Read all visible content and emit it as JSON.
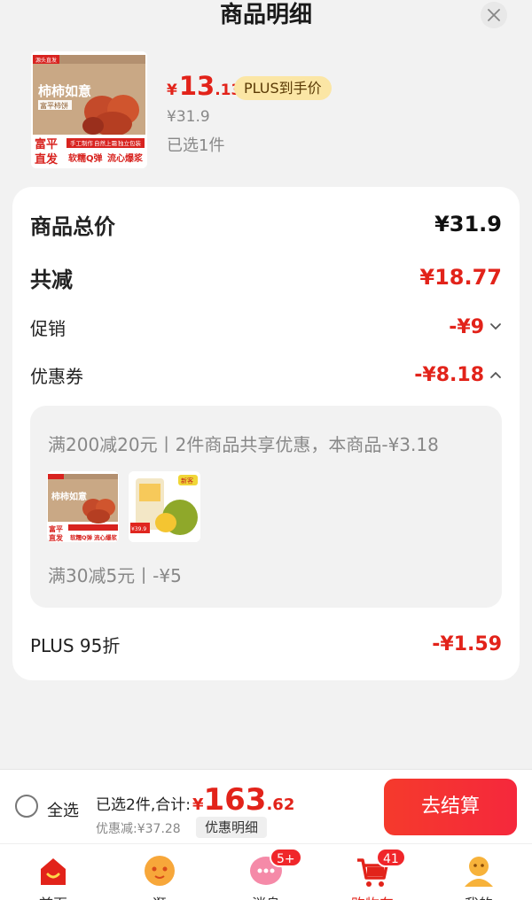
{
  "header": {
    "title": "商品明细"
  },
  "product": {
    "price_currency": "¥",
    "price_int": "13",
    "price_dec": ".13",
    "plus_badge": "PLUS到手价",
    "original_price": "¥31.9",
    "selected": "已选1件",
    "thumb_text": {
      "brand": "源头直发",
      "name": "柿柿如意",
      "sub": "富平柿饼",
      "origin_line1": "富平",
      "origin_line2": "直发",
      "tag1": "手工制作",
      "tag2": "自然上霜",
      "tag3": "独立包装",
      "slogan1": "软糯Q弹",
      "slogan2": "流心爆浆"
    }
  },
  "details": {
    "total_label": "商品总价",
    "total_value": "¥31.9",
    "reduce_label": "共减",
    "reduce_value": "¥18.77",
    "promo_label": "促销",
    "promo_value": "-¥9",
    "coupon_label": "优惠券",
    "coupon_value": "-¥8.18",
    "coupon_box": {
      "desc1": "满200减20元丨2件商品共享优惠，本商品-¥3.18",
      "item2_tag": "新客",
      "item2_price": "¥39.9",
      "desc2": "满30减5元丨-¥5"
    },
    "plus_label": "PLUS 95折",
    "plus_value": "-¥1.59"
  },
  "bottom_bar": {
    "select_all": "全选",
    "summary": "已选2件,合计:",
    "total_currency": "¥",
    "total_int": "163",
    "total_dec": ".62",
    "discount": "优惠减:¥37.28",
    "detail_chip": "优惠明细",
    "checkout": "去结算"
  },
  "tabbar": {
    "tabs": [
      {
        "label": "首页"
      },
      {
        "label": "逛"
      },
      {
        "label": "消息",
        "badge": "5+"
      },
      {
        "label": "购物车",
        "badge": "41"
      },
      {
        "label": "我的"
      }
    ]
  },
  "colors": {
    "accent": "#e2231a",
    "plus_badge_bg": "#fbe6a5"
  }
}
